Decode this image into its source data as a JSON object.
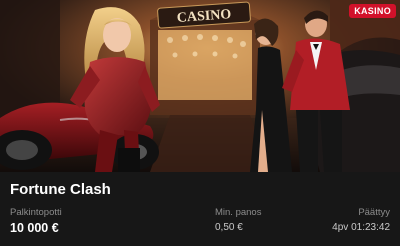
{
  "card": {
    "badge": "KASINO",
    "sign_text": "CASINO",
    "title": "Fortune Clash",
    "stats": [
      {
        "label": "Palkintopotti",
        "value": "10 000 €"
      },
      {
        "label": "Min. panos",
        "value": "0,50 €"
      },
      {
        "label": "Päättyy",
        "value": "4pv 01:23:42"
      }
    ]
  },
  "colors": {
    "badge": "#d2112a",
    "info_bg": "#171717",
    "hero_dark": "#1a1210",
    "hero_warm": "#b8743a"
  }
}
